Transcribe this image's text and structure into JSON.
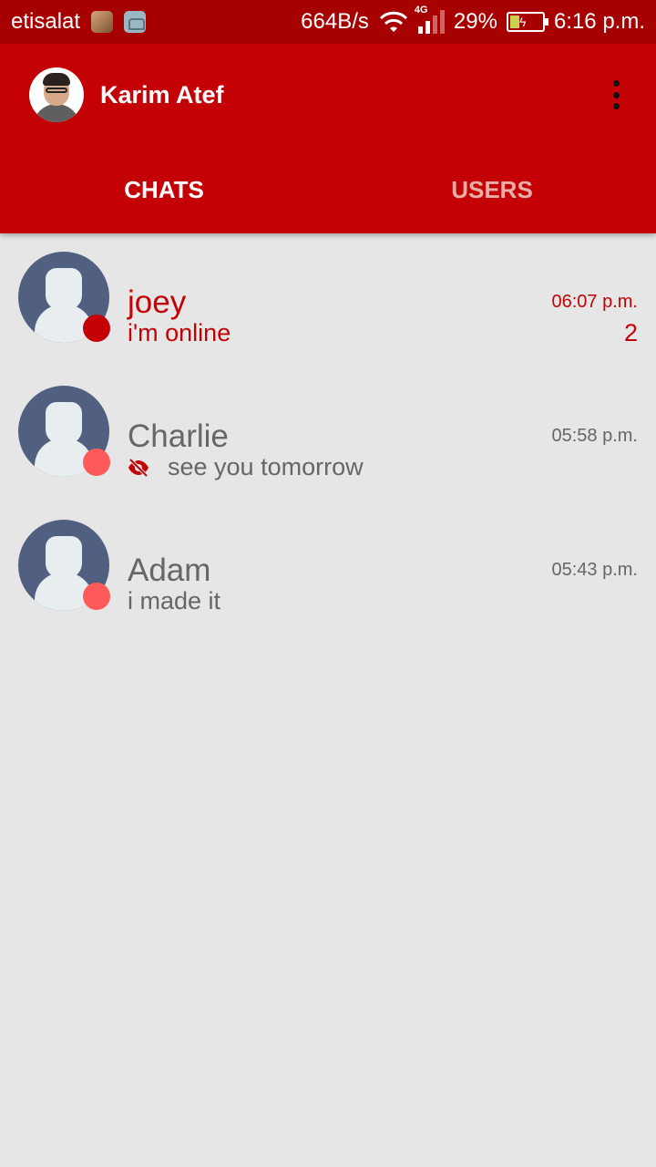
{
  "status_bar": {
    "carrier": "etisalat",
    "network_speed": "664B/s",
    "network_type": "4G",
    "battery": "29%",
    "battery_level": 0.29,
    "time": "6:16 p.m."
  },
  "header": {
    "user_name": "Karim Atef"
  },
  "tabs": [
    {
      "label": "CHATS",
      "active": true
    },
    {
      "label": "USERS",
      "active": false
    }
  ],
  "chats": [
    {
      "name": "joey",
      "message": "i'm online",
      "time": "06:07 p.m.",
      "unread_count": "2",
      "status": "online",
      "seen": false
    },
    {
      "name": "Charlie",
      "message": "see you tomorrow",
      "time": "05:58 p.m.",
      "status": "offline",
      "seen": true
    },
    {
      "name": "Adam",
      "message": "i made it",
      "time": "05:43 p.m.",
      "status": "offline",
      "seen": false
    }
  ],
  "colors": {
    "status_bar": "#a60000",
    "app_bar": "#c40206",
    "background": "#e6e6e6",
    "avatar": "#515f80",
    "online_dot": "#c40206",
    "offline_dot": "#ff5a5a"
  }
}
